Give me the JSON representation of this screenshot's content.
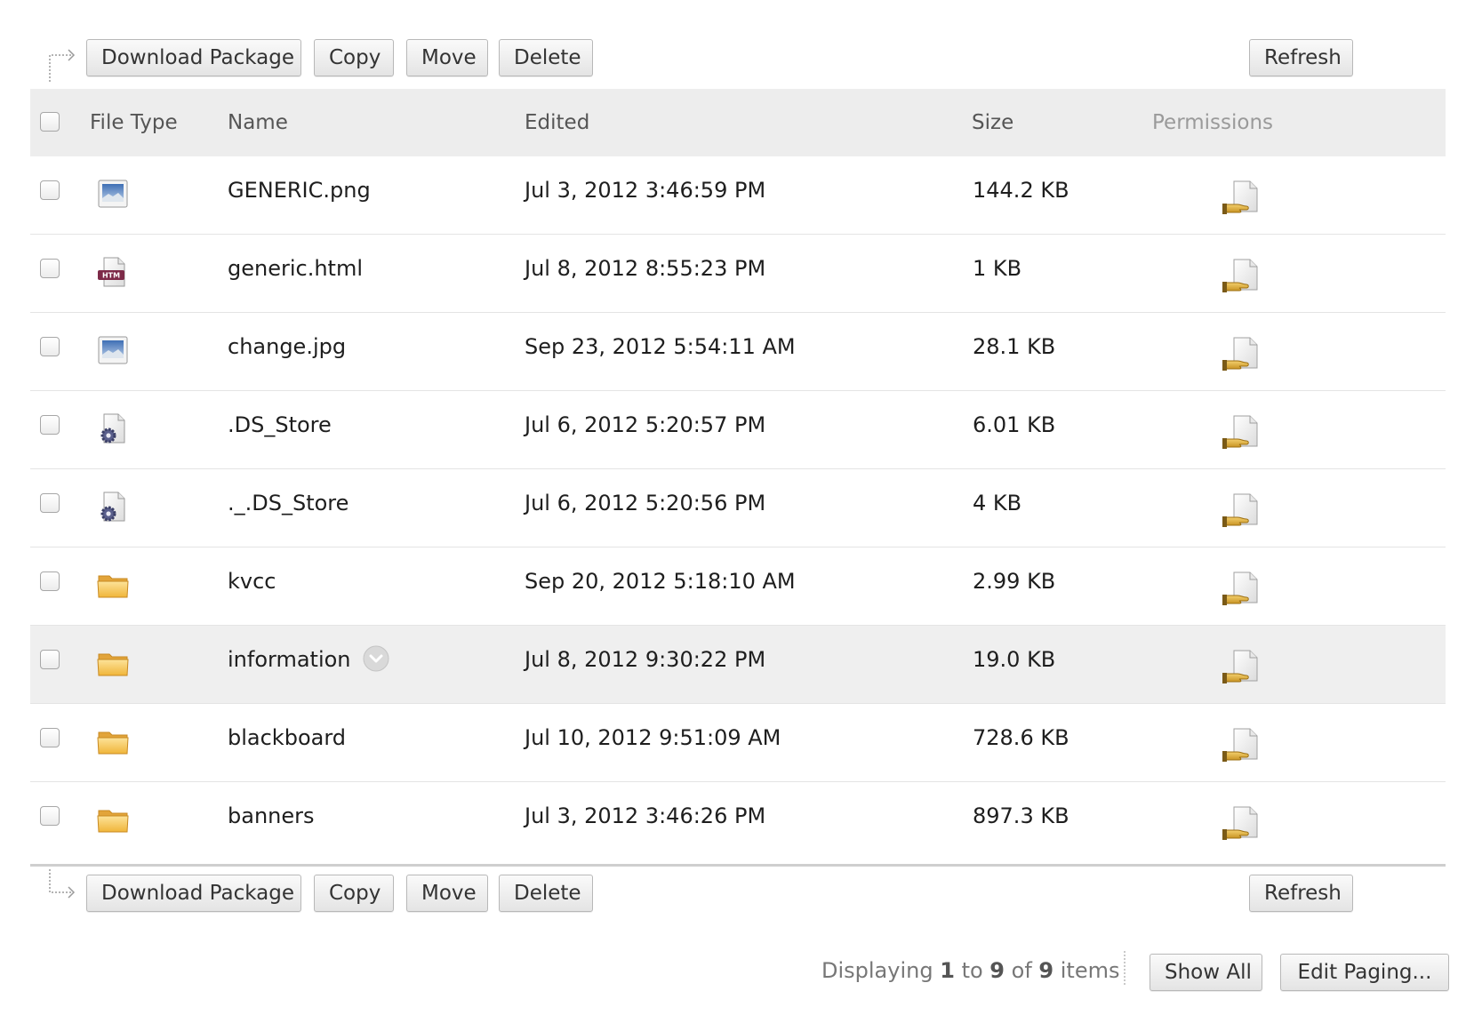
{
  "toolbar": {
    "download_label": "Download Package",
    "copy_label": "Copy",
    "move_label": "Move",
    "delete_label": "Delete",
    "refresh_label": "Refresh"
  },
  "columns": {
    "file_type": "File Type",
    "name": "Name",
    "edited": "Edited",
    "size": "Size",
    "permissions": "Permissions"
  },
  "rows": [
    {
      "type_icon": "image-file-icon",
      "name": "GENERIC.png",
      "edited": "Jul 3, 2012 3:46:59 PM",
      "size": "144.2 KB"
    },
    {
      "type_icon": "html-file-icon",
      "name": "generic.html",
      "edited": "Jul 8, 2012 8:55:23 PM",
      "size": "1 KB"
    },
    {
      "type_icon": "image-file-icon",
      "name": "change.jpg",
      "edited": "Sep 23, 2012 5:54:11 AM",
      "size": "28.1 KB"
    },
    {
      "type_icon": "system-file-icon",
      "name": ".DS_Store",
      "edited": "Jul 6, 2012 5:20:57 PM",
      "size": "6.01 KB"
    },
    {
      "type_icon": "system-file-icon",
      "name": "._.DS_Store",
      "edited": "Jul 6, 2012 5:20:56 PM",
      "size": "4 KB"
    },
    {
      "type_icon": "folder-icon",
      "name": "kvcc",
      "edited": "Sep 20, 2012 5:18:10 AM",
      "size": "2.99 KB"
    },
    {
      "type_icon": "folder-icon",
      "name": "information",
      "edited": "Jul 8, 2012 9:30:22 PM",
      "size": "19.0 KB"
    },
    {
      "type_icon": "folder-icon",
      "name": "blackboard",
      "edited": "Jul 10, 2012 9:51:09 AM",
      "size": "728.6 KB"
    },
    {
      "type_icon": "folder-icon",
      "name": "banners",
      "edited": "Jul 3, 2012 3:46:26 PM",
      "size": "897.3 KB"
    }
  ],
  "html_icon_text": "HTM",
  "paging": {
    "prefix": "Displaying",
    "from": "1",
    "to_word": "to",
    "to": "9",
    "of_word": "of",
    "total": "9",
    "suffix": "items",
    "show_all_label": "Show All",
    "edit_paging_label": "Edit Paging..."
  },
  "colors": {
    "folder": "#f5c04a",
    "header_bg": "#ededed",
    "highlight_row": "#efefef"
  }
}
